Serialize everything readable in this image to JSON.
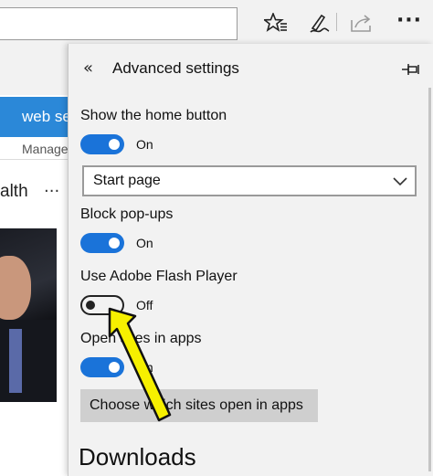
{
  "browser": {
    "toolbar_icons": [
      "favorites-star-icon",
      "web-note-pen-icon",
      "share-icon"
    ],
    "more_label": "···"
  },
  "page": {
    "search_button_label": "web se",
    "manage_label": "Manage",
    "section_heading": "alth",
    "section_more": "···"
  },
  "panel": {
    "title": "Advanced settings",
    "back_icon": "«",
    "pin_icon": "pin-icon",
    "home_button": {
      "label": "Show the home button",
      "state": "On"
    },
    "home_select": {
      "value": "Start page"
    },
    "popups": {
      "label": "Block pop-ups",
      "state": "On"
    },
    "flash": {
      "label": "Use Adobe Flash Player",
      "state": "Off"
    },
    "open_sites": {
      "label": "Open sites in apps",
      "state": "On"
    },
    "choose_button": "Choose which sites open in apps",
    "downloads_heading": "Downloads"
  },
  "colors": {
    "toggle_on": "#1a73d9",
    "panel_bg": "#f2f2f2",
    "search_blue": "#2b88d8",
    "arrow_fill": "#f6f000"
  }
}
